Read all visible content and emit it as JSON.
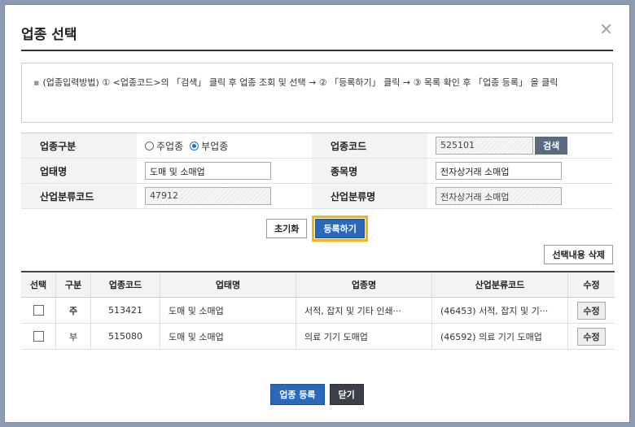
{
  "dialog": {
    "title": "업종 선택",
    "close_icon": "×"
  },
  "guide": {
    "bullet": "▪",
    "text": "(업종입력방법) ① <업종코드>의 「검색」 클릭 후 업종 조회 및 선택 → ② 「등록하기」 클릭 → ③ 목록 확인 후 「업종 등록」 을 클릭"
  },
  "form": {
    "type_label": "업종구분",
    "radio_main": "주업종",
    "radio_sub": "부업종",
    "radio_selected": "부업종",
    "code_label": "업종코드",
    "code_value": "525101",
    "search_button": "검색",
    "biz_label": "업태명",
    "biz_value": "도매 및 소매업",
    "item_label": "종목명",
    "item_value": "전자상거래 소매업",
    "ind_code_label": "산업분류코드",
    "ind_code_value": "47912",
    "ind_name_label": "산업분류명",
    "ind_name_value": "전자상거래 소매업"
  },
  "actions": {
    "reset": "초기화",
    "register": "등록하기",
    "delete_selected": "선택내용 삭제"
  },
  "table": {
    "headers": [
      "선택",
      "구분",
      "업종코드",
      "업태명",
      "업종명",
      "산업분류코드",
      "수정"
    ],
    "rows": [
      {
        "type": "주",
        "code": "513421",
        "biz": "도매 및 소매업",
        "name": "서적, 잡지 및 기타 인쇄···",
        "ind": "(46453) 서적, 잡지 및 기···",
        "edit": "수정"
      },
      {
        "type": "부",
        "code": "515080",
        "biz": "도매 및 소매업",
        "name": "의료 기기 도매업",
        "ind": "(46592) 의료 기기 도매업",
        "edit": "수정"
      }
    ]
  },
  "footer": {
    "submit": "업종 등록",
    "close": "닫기"
  },
  "colors": {
    "accent": "#2b69b8",
    "highlight": "#f5b40f",
    "main_type": "#d62a2a"
  }
}
